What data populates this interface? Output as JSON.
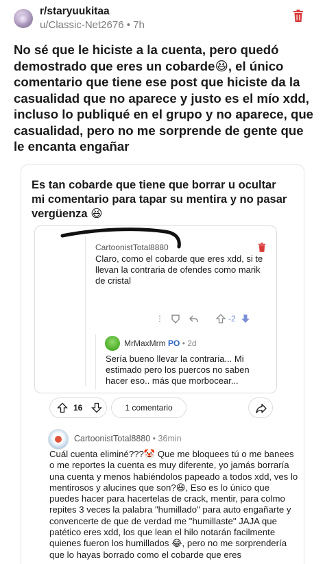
{
  "header": {
    "subreddit": "r/staryuukitaa",
    "author": "u/Classic-Net2676",
    "age": "7h",
    "separator": "•"
  },
  "post": {
    "title": "No sé que le hiciste a la cuenta, pero quedó demostrado que eres un cobarde😆, el único comentario que tiene ese post que hiciste da la casualidad que no aparece y justo es el mío xdd, incluso lo publiqué en el grupo y no aparece, que casualidad, pero no me sorprende de gente que le encanta engañar"
  },
  "image": {
    "caption": "Es tan cobarde que tiene que borrar u ocultar mi comentario para tapar su mentira y no pasar vergüenza 😆",
    "inner_comment_1": {
      "author": "CartoonistTotal8880",
      "text": "Claro, como el cobarde que eres xdd, si te llevan la contraria de ofendes como marik de cristal",
      "vote_label": "-2"
    },
    "inner_comment_2": {
      "author": "MrMaxMrm",
      "badge": "PO",
      "age": "2d",
      "text": "Sería bueno llevar la contraria... Mi estimado pero los puercos no saben hacer eso.. más que morbocear..."
    },
    "post_actions": {
      "votes": "16",
      "comments_label": "1 comentario"
    },
    "reply": {
      "author": "CartoonistTotal8880",
      "age": "36min",
      "text": "Cuál cuenta eliminé???🤡 Que me bloquees tú o me banees o me reportes la cuenta es muy diferente, yo jamás borraría una cuenta y menos habiéndolos papeado a todos xdd, ves lo mentirosos y alucines que son?😆, Eso es lo único que puedes hacer para hacertelas de crack, mentir, para colmo repites 3 veces la palabra \"humillado\" para auto engañarte y convencerte de que de verdad me \"humillaste\" JAJA que patético eres xdd, los que lean el hilo notarán facilmente quienes fueron los humillados 😂, pero no me sorprendería que lo hayas borrado como el cobarde que eres"
    }
  },
  "colors": {
    "accent_red": "#d93a3a",
    "meta_gray": "#7c7c7c",
    "op_blue": "#2a64c5"
  },
  "icons": [
    "trash-icon",
    "upvote-icon",
    "downvote-icon",
    "share-icon",
    "reply-icon",
    "award-icon",
    "more-icon"
  ]
}
